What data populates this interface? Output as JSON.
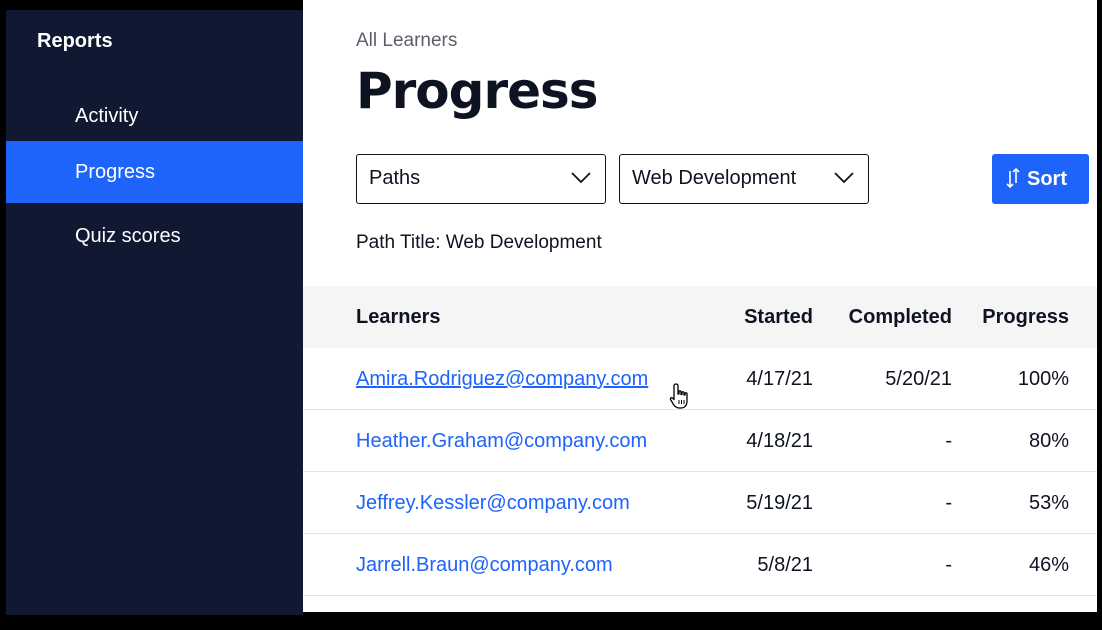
{
  "sidebar": {
    "header": "Reports",
    "items": [
      {
        "label": "Activity",
        "active": false
      },
      {
        "label": "Progress",
        "active": true
      },
      {
        "label": "Quiz scores",
        "active": false
      }
    ]
  },
  "main": {
    "breadcrumb": "All Learners",
    "title": "Progress",
    "filters": {
      "type_select": "Paths",
      "path_select": "Web Development"
    },
    "sort_label": "Sort",
    "path_title": "Path Title: Web Development"
  },
  "table": {
    "headers": {
      "learners": "Learners",
      "started": "Started",
      "completed": "Completed",
      "progress": "Progress"
    },
    "rows": [
      {
        "email": "Amira.Rodriguez@company.com",
        "started": "4/17/21",
        "completed": "5/20/21",
        "progress": "100%"
      },
      {
        "email": "Heather.Graham@company.com",
        "started": "4/18/21",
        "completed": "-",
        "progress": "80%"
      },
      {
        "email": "Jeffrey.Kessler@company.com",
        "started": "5/19/21",
        "completed": "-",
        "progress": "53%"
      },
      {
        "email": "Jarrell.Braun@company.com",
        "started": "5/8/21",
        "completed": "-",
        "progress": "46%"
      }
    ]
  },
  "colors": {
    "sidebar_bg": "#111831",
    "accent": "#1e63fa",
    "text": "#0e1322"
  },
  "icons": [
    "chevron-down-icon",
    "sort-icon",
    "hand-pointer-icon"
  ]
}
